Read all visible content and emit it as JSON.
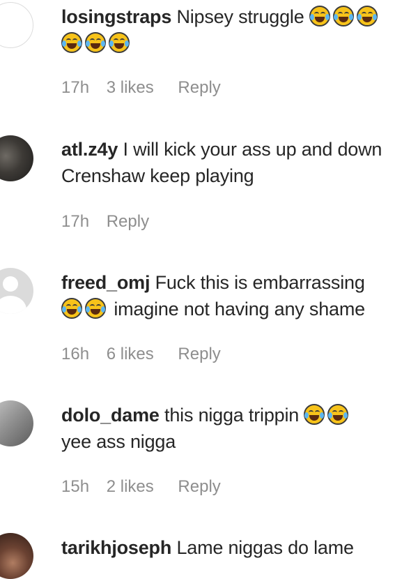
{
  "comments": [
    {
      "username": "losingstraps",
      "text": "Nipsey struggle",
      "emoji_count": 6,
      "emoji_icon": "rolling-laughing-emoji",
      "time": "17h",
      "likes": "3 likes",
      "reply": "Reply"
    },
    {
      "username": "atl.z4y",
      "text": "I will kick your ass up and down Crenshaw keep playing",
      "time": "17h",
      "likes": "",
      "reply": "Reply"
    },
    {
      "username": "freed_omj",
      "text": "Fuck this is embarrassing",
      "text_after_emoji": "imagine not having any shame",
      "emoji_count": 2,
      "emoji_icon": "tears-of-joy-emoji",
      "time": "16h",
      "likes": "6 likes",
      "reply": "Reply"
    },
    {
      "username": "dolo_dame",
      "text": "this nigga trippin",
      "text_line2": "yee ass nigga",
      "emoji_count": 2,
      "emoji_icon": "tears-of-joy-emoji",
      "time": "15h",
      "likes": "2 likes",
      "reply": "Reply"
    },
    {
      "username": "tarikhjoseph",
      "text": "Lame niggas do lame"
    }
  ]
}
